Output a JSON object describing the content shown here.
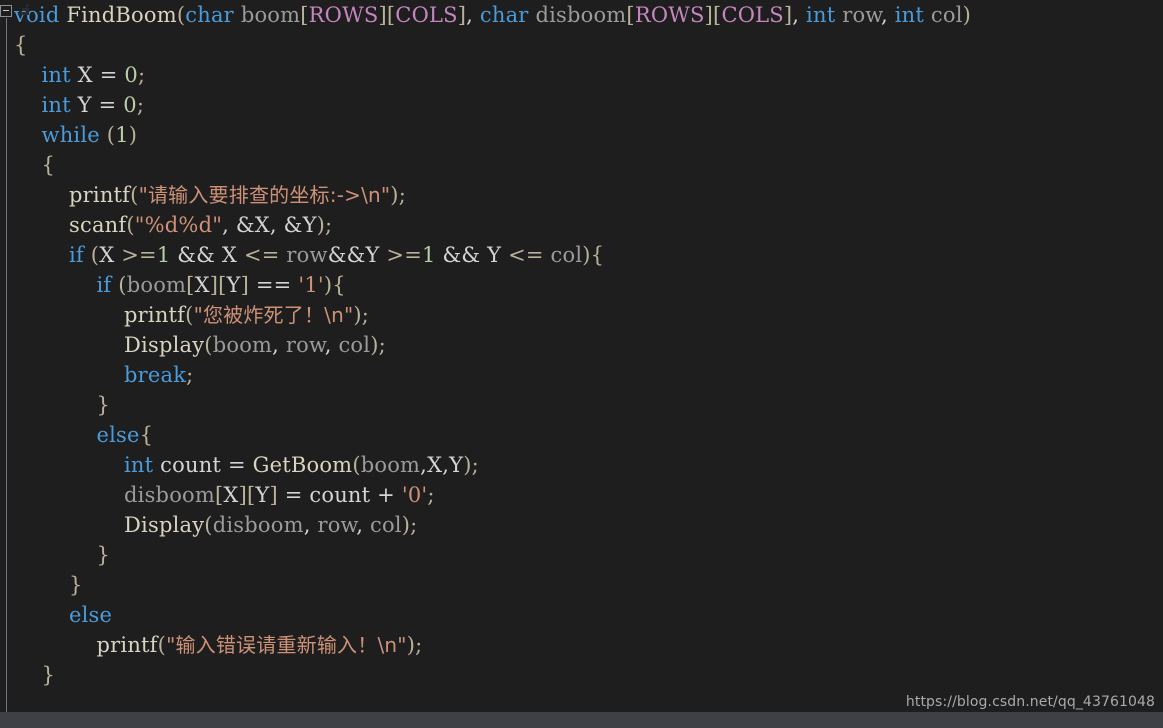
{
  "window": {
    "title": "FindBoom",
    "language": "C",
    "theme": "dark"
  },
  "colors": {
    "background": "#1e1e1e",
    "foreground": "#d4d4d4",
    "keyword": "#4a9bdc",
    "function": "#d8d4c0",
    "variable": "#9b9b9b",
    "macro": "#c586c0",
    "string": "#ce9178",
    "number": "#b5cea8",
    "punctuation": "#b9b199",
    "scrollbar_track": "#3f3f46",
    "fold_line": "#6e7681",
    "watermark": "#b6b6b6"
  },
  "gutter": {
    "fold_toggle_state": "expanded",
    "fold_toggle_glyph": "minus-box"
  },
  "watermark": {
    "text": "https://blog.csdn.net/qq_43761048"
  },
  "scrollbar": {
    "orientation": "horizontal",
    "position": 0
  },
  "code": {
    "lines": [
      {
        "indent": 0,
        "tokens": [
          {
            "text": "void",
            "cls": "t-keyword"
          },
          {
            "text": " ",
            "cls": "t-plain"
          },
          {
            "text": "FindBoom",
            "cls": "t-func"
          },
          {
            "text": "(",
            "cls": "t-punct"
          },
          {
            "text": "char",
            "cls": "t-keyword"
          },
          {
            "text": " ",
            "cls": "t-plain"
          },
          {
            "text": "boom",
            "cls": "t-var"
          },
          {
            "text": "[",
            "cls": "t-punct"
          },
          {
            "text": "ROWS",
            "cls": "t-macro"
          },
          {
            "text": "]",
            "cls": "t-punct"
          },
          {
            "text": "[",
            "cls": "t-punct"
          },
          {
            "text": "COLS",
            "cls": "t-macro"
          },
          {
            "text": "]",
            "cls": "t-punct"
          },
          {
            "text": ", ",
            "cls": "t-plain"
          },
          {
            "text": "char",
            "cls": "t-keyword"
          },
          {
            "text": " ",
            "cls": "t-plain"
          },
          {
            "text": "disboom",
            "cls": "t-var"
          },
          {
            "text": "[",
            "cls": "t-punct"
          },
          {
            "text": "ROWS",
            "cls": "t-macro"
          },
          {
            "text": "]",
            "cls": "t-punct"
          },
          {
            "text": "[",
            "cls": "t-punct"
          },
          {
            "text": "COLS",
            "cls": "t-macro"
          },
          {
            "text": "]",
            "cls": "t-punct"
          },
          {
            "text": ", ",
            "cls": "t-plain"
          },
          {
            "text": "int",
            "cls": "t-keyword"
          },
          {
            "text": " ",
            "cls": "t-plain"
          },
          {
            "text": "row",
            "cls": "t-var"
          },
          {
            "text": ", ",
            "cls": "t-plain"
          },
          {
            "text": "int",
            "cls": "t-keyword"
          },
          {
            "text": " ",
            "cls": "t-plain"
          },
          {
            "text": "col",
            "cls": "t-var"
          },
          {
            "text": ")",
            "cls": "t-punct"
          }
        ]
      },
      {
        "indent": 0,
        "tokens": [
          {
            "text": "{",
            "cls": "t-brace"
          }
        ]
      },
      {
        "indent": 1,
        "tokens": [
          {
            "text": "int",
            "cls": "t-keyword"
          },
          {
            "text": " X ",
            "cls": "t-plain"
          },
          {
            "text": "= ",
            "cls": "t-operator"
          },
          {
            "text": "0",
            "cls": "t-number"
          },
          {
            "text": ";",
            "cls": "t-punct"
          }
        ]
      },
      {
        "indent": 1,
        "tokens": [
          {
            "text": "int",
            "cls": "t-keyword"
          },
          {
            "text": " Y ",
            "cls": "t-plain"
          },
          {
            "text": "= ",
            "cls": "t-operator"
          },
          {
            "text": "0",
            "cls": "t-number"
          },
          {
            "text": ";",
            "cls": "t-punct"
          }
        ]
      },
      {
        "indent": 1,
        "tokens": [
          {
            "text": "while",
            "cls": "t-control"
          },
          {
            "text": " ",
            "cls": "t-plain"
          },
          {
            "text": "(",
            "cls": "t-punct"
          },
          {
            "text": "1",
            "cls": "t-number"
          },
          {
            "text": ")",
            "cls": "t-punct"
          }
        ]
      },
      {
        "indent": 1,
        "tokens": [
          {
            "text": "{",
            "cls": "t-brace"
          }
        ]
      },
      {
        "indent": 2,
        "tokens": [
          {
            "text": "printf",
            "cls": "t-func"
          },
          {
            "text": "(",
            "cls": "t-punct"
          },
          {
            "text": "\"请输入要排查的坐标:->\\n\"",
            "cls": "t-string",
            "cjk": true
          },
          {
            "text": ")",
            "cls": "t-punct"
          },
          {
            "text": ";",
            "cls": "t-punct"
          }
        ]
      },
      {
        "indent": 2,
        "tokens": [
          {
            "text": "scanf",
            "cls": "t-func"
          },
          {
            "text": "(",
            "cls": "t-punct"
          },
          {
            "text": "\"%d%d\"",
            "cls": "t-string"
          },
          {
            "text": ", ",
            "cls": "t-plain"
          },
          {
            "text": "&X",
            "cls": "t-plain"
          },
          {
            "text": ", ",
            "cls": "t-plain"
          },
          {
            "text": "&Y",
            "cls": "t-plain"
          },
          {
            "text": ")",
            "cls": "t-punct"
          },
          {
            "text": ";",
            "cls": "t-punct"
          }
        ]
      },
      {
        "indent": 2,
        "tokens": [
          {
            "text": "if",
            "cls": "t-control"
          },
          {
            "text": " ",
            "cls": "t-plain"
          },
          {
            "text": "(",
            "cls": "t-punct"
          },
          {
            "text": "X ",
            "cls": "t-plain"
          },
          {
            "text": ">=",
            "cls": "t-punct"
          },
          {
            "text": "1",
            "cls": "t-number"
          },
          {
            "text": " && X ",
            "cls": "t-plain"
          },
          {
            "text": "<= ",
            "cls": "t-punct"
          },
          {
            "text": "row",
            "cls": "t-var"
          },
          {
            "text": "&&Y ",
            "cls": "t-plain"
          },
          {
            "text": ">=",
            "cls": "t-punct"
          },
          {
            "text": "1",
            "cls": "t-number"
          },
          {
            "text": " && Y ",
            "cls": "t-plain"
          },
          {
            "text": "<= ",
            "cls": "t-punct"
          },
          {
            "text": "col",
            "cls": "t-var"
          },
          {
            "text": ")",
            "cls": "t-punct"
          },
          {
            "text": "{",
            "cls": "t-brace"
          }
        ]
      },
      {
        "indent": 3,
        "tokens": [
          {
            "text": "if",
            "cls": "t-control"
          },
          {
            "text": " ",
            "cls": "t-plain"
          },
          {
            "text": "(",
            "cls": "t-punct"
          },
          {
            "text": "boom",
            "cls": "t-var"
          },
          {
            "text": "[",
            "cls": "t-punct"
          },
          {
            "text": "X",
            "cls": "t-plain"
          },
          {
            "text": "]",
            "cls": "t-punct"
          },
          {
            "text": "[",
            "cls": "t-punct"
          },
          {
            "text": "Y",
            "cls": "t-plain"
          },
          {
            "text": "]",
            "cls": "t-punct"
          },
          {
            "text": " == ",
            "cls": "t-plain"
          },
          {
            "text": "'1'",
            "cls": "t-string"
          },
          {
            "text": ")",
            "cls": "t-punct"
          },
          {
            "text": "{",
            "cls": "t-brace"
          }
        ]
      },
      {
        "indent": 4,
        "tokens": [
          {
            "text": "printf",
            "cls": "t-func"
          },
          {
            "text": "(",
            "cls": "t-punct"
          },
          {
            "text": "\"您被炸死了！\\n\"",
            "cls": "t-string",
            "cjk": true
          },
          {
            "text": ")",
            "cls": "t-punct"
          },
          {
            "text": ";",
            "cls": "t-punct"
          }
        ]
      },
      {
        "indent": 4,
        "tokens": [
          {
            "text": "Display",
            "cls": "t-func"
          },
          {
            "text": "(",
            "cls": "t-punct"
          },
          {
            "text": "boom",
            "cls": "t-var"
          },
          {
            "text": ", ",
            "cls": "t-plain"
          },
          {
            "text": "row",
            "cls": "t-var"
          },
          {
            "text": ", ",
            "cls": "t-plain"
          },
          {
            "text": "col",
            "cls": "t-var"
          },
          {
            "text": ")",
            "cls": "t-punct"
          },
          {
            "text": ";",
            "cls": "t-punct"
          }
        ]
      },
      {
        "indent": 4,
        "tokens": [
          {
            "text": "break",
            "cls": "t-control"
          },
          {
            "text": ";",
            "cls": "t-punct"
          }
        ]
      },
      {
        "indent": 3,
        "tokens": [
          {
            "text": "}",
            "cls": "t-brace"
          }
        ]
      },
      {
        "indent": 3,
        "tokens": [
          {
            "text": "else",
            "cls": "t-control"
          },
          {
            "text": "{",
            "cls": "t-brace"
          }
        ]
      },
      {
        "indent": 4,
        "tokens": [
          {
            "text": "int",
            "cls": "t-keyword"
          },
          {
            "text": " count ",
            "cls": "t-plain"
          },
          {
            "text": "= ",
            "cls": "t-operator"
          },
          {
            "text": "GetBoom",
            "cls": "t-func"
          },
          {
            "text": "(",
            "cls": "t-punct"
          },
          {
            "text": "boom",
            "cls": "t-var"
          },
          {
            "text": ",",
            "cls": "t-plain"
          },
          {
            "text": "X",
            "cls": "t-plain"
          },
          {
            "text": ",",
            "cls": "t-plain"
          },
          {
            "text": "Y",
            "cls": "t-plain"
          },
          {
            "text": ")",
            "cls": "t-punct"
          },
          {
            "text": ";",
            "cls": "t-punct"
          }
        ]
      },
      {
        "indent": 4,
        "tokens": [
          {
            "text": "disboom",
            "cls": "t-var"
          },
          {
            "text": "[",
            "cls": "t-punct"
          },
          {
            "text": "X",
            "cls": "t-plain"
          },
          {
            "text": "]",
            "cls": "t-punct"
          },
          {
            "text": "[",
            "cls": "t-punct"
          },
          {
            "text": "Y",
            "cls": "t-plain"
          },
          {
            "text": "]",
            "cls": "t-punct"
          },
          {
            "text": " = count + ",
            "cls": "t-plain"
          },
          {
            "text": "'0'",
            "cls": "t-string"
          },
          {
            "text": ";",
            "cls": "t-punct"
          }
        ]
      },
      {
        "indent": 4,
        "tokens": [
          {
            "text": "Display",
            "cls": "t-func"
          },
          {
            "text": "(",
            "cls": "t-punct"
          },
          {
            "text": "disboom",
            "cls": "t-var"
          },
          {
            "text": ", ",
            "cls": "t-plain"
          },
          {
            "text": "row",
            "cls": "t-var"
          },
          {
            "text": ", ",
            "cls": "t-plain"
          },
          {
            "text": "col",
            "cls": "t-var"
          },
          {
            "text": ")",
            "cls": "t-punct"
          },
          {
            "text": ";",
            "cls": "t-punct"
          }
        ]
      },
      {
        "indent": 3,
        "tokens": [
          {
            "text": "}",
            "cls": "t-brace"
          }
        ]
      },
      {
        "indent": 2,
        "tokens": [
          {
            "text": "}",
            "cls": "t-brace"
          }
        ]
      },
      {
        "indent": 2,
        "tokens": [
          {
            "text": "else",
            "cls": "t-control"
          }
        ]
      },
      {
        "indent": 3,
        "tokens": [
          {
            "text": "printf",
            "cls": "t-func"
          },
          {
            "text": "(",
            "cls": "t-punct"
          },
          {
            "text": "\"输入错误请重新输入！\\n\"",
            "cls": "t-string",
            "cjk": true
          },
          {
            "text": ")",
            "cls": "t-punct"
          },
          {
            "text": ";",
            "cls": "t-punct"
          }
        ]
      },
      {
        "indent": 1,
        "tokens": [
          {
            "text": "}",
            "cls": "t-brace"
          }
        ]
      },
      {
        "indent": 0,
        "tokens": []
      }
    ]
  }
}
